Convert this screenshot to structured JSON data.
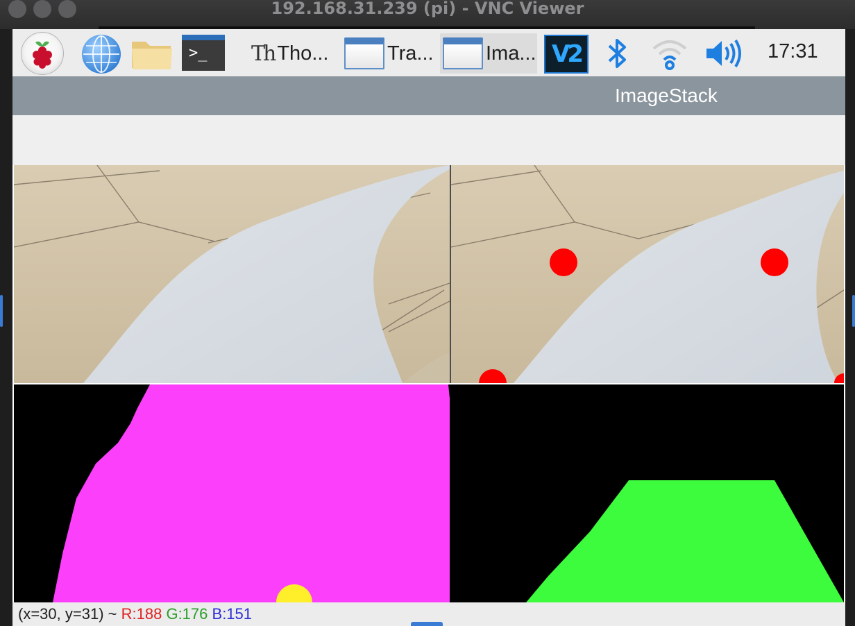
{
  "window": {
    "title": "192.168.31.239 (pi) - VNC Viewer"
  },
  "taskbar": {
    "apps": [
      {
        "icon": "raspberry-menu-icon"
      },
      {
        "icon": "web-browser-icon"
      },
      {
        "icon": "file-manager-icon"
      },
      {
        "icon": "terminal-icon",
        "glyph": ">_"
      }
    ],
    "tasks": [
      {
        "label": "Tho...",
        "icon": "thonny-icon",
        "active": false
      },
      {
        "label": "Tra...",
        "icon": "window-icon",
        "active": false
      },
      {
        "label": "Ima...",
        "icon": "window-icon",
        "active": true
      }
    ],
    "tray": {
      "vnc_glyph": "V2",
      "bluetooth": "bluetooth-icon",
      "wifi": "wifi-icon",
      "volume": "volume-icon",
      "clock": "17:31"
    }
  },
  "imagestack": {
    "title": "ImageStack",
    "status": {
      "coords": "(x=30, y=31) ~",
      "r": "R:188",
      "g": "G:176",
      "b": "B:151"
    },
    "colors": {
      "mask_magenta": "#fb3ffb",
      "mask_green": "#3dfb3d",
      "marker_red": "#ff0000",
      "marker_yellow": "#ffef2a"
    }
  }
}
